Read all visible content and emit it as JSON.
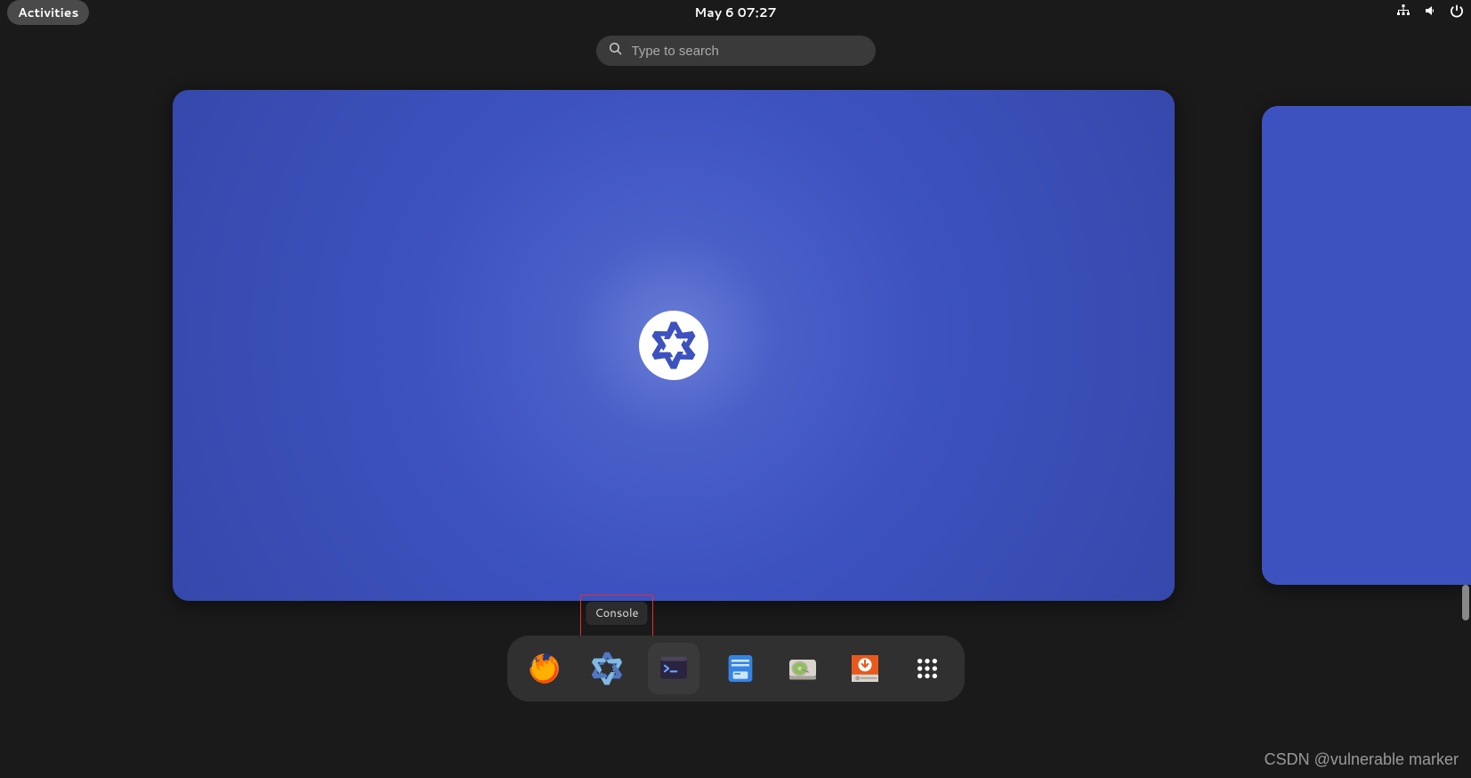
{
  "topbar": {
    "activities_label": "Activities",
    "clock": "May 6  07:27"
  },
  "search": {
    "placeholder": "Type to search"
  },
  "tooltip": {
    "console": "Console"
  },
  "dash": {
    "items": [
      {
        "name": "firefox"
      },
      {
        "name": "nixos-manual"
      },
      {
        "name": "console"
      },
      {
        "name": "files"
      },
      {
        "name": "disks"
      },
      {
        "name": "installer"
      },
      {
        "name": "show-apps"
      }
    ]
  },
  "watermark": "CSDN @vulnerable marker",
  "colors": {
    "wallpaper": "#3d52bf",
    "highlight_box": "#e03131"
  }
}
